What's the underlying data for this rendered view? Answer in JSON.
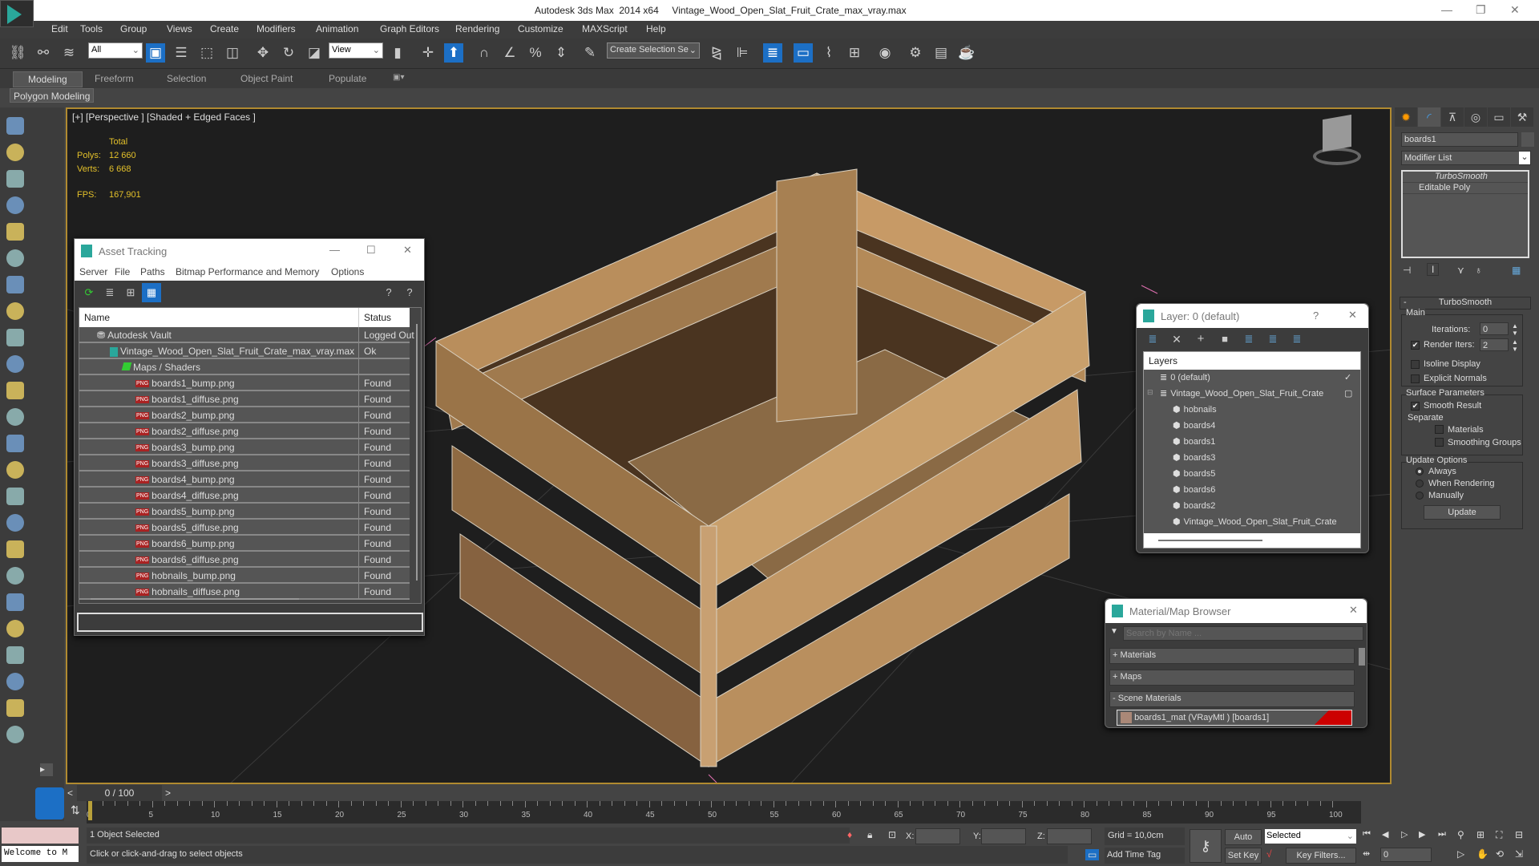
{
  "title": "Autodesk 3ds Max  2014 x64     Vintage_Wood_Open_Slat_Fruit_Crate_max_vray.max",
  "menu": [
    "Edit",
    "Tools",
    "Group",
    "Views",
    "Create",
    "Modifiers",
    "Animation",
    "Graph Editors",
    "Rendering",
    "Customize",
    "MAXScript",
    "Help"
  ],
  "toolbar": {
    "filter": "All",
    "ref_coord": "View",
    "selection_set": "Create Selection Se"
  },
  "ribbon": {
    "tabs": [
      "Modeling",
      "Freeform",
      "Selection",
      "Object Paint",
      "Populate"
    ],
    "panel": "Polygon Modeling"
  },
  "viewport": {
    "label": "[+] [Perspective ] [Shaded + Edged Faces ]",
    "total": "Total",
    "polys_label": "Polys:",
    "polys": "12 660",
    "verts_label": "Verts:",
    "verts": "6 668",
    "fps_label": "FPS:",
    "fps": "167,901"
  },
  "asset_tracking": {
    "title": "Asset Tracking",
    "menu": [
      "Server",
      "File",
      "Paths",
      "Bitmap Performance and Memory",
      "Options"
    ],
    "columns": [
      "Name",
      "Status"
    ],
    "rows": [
      {
        "name": "Autodesk Vault",
        "status": "Logged Out",
        "level": 1
      },
      {
        "name": "Vintage_Wood_Open_Slat_Fruit_Crate_max_vray.max",
        "status": "Ok",
        "level": 2
      },
      {
        "name": "Maps / Shaders",
        "status": "",
        "level": 3
      },
      {
        "name": "boards1_bump.png",
        "status": "Found",
        "level": 4
      },
      {
        "name": "boards1_diffuse.png",
        "status": "Found",
        "level": 4
      },
      {
        "name": "boards2_bump.png",
        "status": "Found",
        "level": 4
      },
      {
        "name": "boards2_diffuse.png",
        "status": "Found",
        "level": 4
      },
      {
        "name": "boards3_bump.png",
        "status": "Found",
        "level": 4
      },
      {
        "name": "boards3_diffuse.png",
        "status": "Found",
        "level": 4
      },
      {
        "name": "boards4_bump.png",
        "status": "Found",
        "level": 4
      },
      {
        "name": "boards4_diffuse.png",
        "status": "Found",
        "level": 4
      },
      {
        "name": "boards5_bump.png",
        "status": "Found",
        "level": 4
      },
      {
        "name": "boards5_diffuse.png",
        "status": "Found",
        "level": 4
      },
      {
        "name": "boards6_bump.png",
        "status": "Found",
        "level": 4
      },
      {
        "name": "boards6_diffuse.png",
        "status": "Found",
        "level": 4
      },
      {
        "name": "hobnails_bump.png",
        "status": "Found",
        "level": 4
      },
      {
        "name": "hobnails_diffuse.png",
        "status": "Found",
        "level": 4
      }
    ]
  },
  "layer_dialog": {
    "title": "Layer: 0 (default)",
    "help": "?",
    "header": "Layers",
    "items": [
      {
        "name": "0 (default)",
        "level": 0,
        "mark": "✓"
      },
      {
        "name": "Vintage_Wood_Open_Slat_Fruit_Crate",
        "level": 0,
        "mark": "▢"
      },
      {
        "name": "hobnails",
        "level": 1
      },
      {
        "name": "boards4",
        "level": 1
      },
      {
        "name": "boards1",
        "level": 1
      },
      {
        "name": "boards3",
        "level": 1
      },
      {
        "name": "boards5",
        "level": 1
      },
      {
        "name": "boards6",
        "level": 1
      },
      {
        "name": "boards2",
        "level": 1
      },
      {
        "name": "Vintage_Wood_Open_Slat_Fruit_Crate",
        "level": 1
      }
    ]
  },
  "material_browser": {
    "title": "Material/Map Browser",
    "search_placeholder": "Search by Name ...",
    "sections": [
      "+ Materials",
      "+ Maps",
      "- Scene Materials"
    ],
    "material": "boards1_mat  (VRayMtl ) [boards1]"
  },
  "command_panel": {
    "object_name": "boards1",
    "modifier_list": "Modifier List",
    "stack": [
      "TurboSmooth",
      "Editable Poly"
    ],
    "rollout": "TurboSmooth",
    "main": "Main",
    "iterations_label": "Iterations:",
    "iterations": "0",
    "render_iters_label": "Render Iters:",
    "render_iters": "2",
    "isoline": "Isoline Display",
    "explicit": "Explicit Normals",
    "surface": "Surface Parameters",
    "smooth_result": "Smooth Result",
    "separate": "Separate",
    "materials": "Materials",
    "smoothing_groups": "Smoothing Groups",
    "update_options": "Update Options",
    "always": "Always",
    "when_rendering": "When Rendering",
    "manually": "Manually",
    "update": "Update"
  },
  "timeline": {
    "frame": "0 / 100",
    "ticks": [
      "0",
      "5",
      "10",
      "15",
      "20",
      "25",
      "30",
      "35",
      "40",
      "45",
      "50",
      "55",
      "60",
      "65",
      "70",
      "75",
      "80",
      "85",
      "90",
      "95",
      "100"
    ]
  },
  "status": {
    "welcome": "Welcome to M",
    "selected": "1 Object Selected",
    "prompt": "Click or click-and-drag to select objects",
    "x": "X:",
    "y": "Y:",
    "z": "Z:",
    "grid": "Grid = 10,0cm",
    "add_time_tag": "Add Time Tag",
    "auto_key": "Auto Key",
    "set_key": "Set Key",
    "key_mode": "Selected",
    "key_filters": "Key Filters...",
    "current_frame": "0"
  }
}
